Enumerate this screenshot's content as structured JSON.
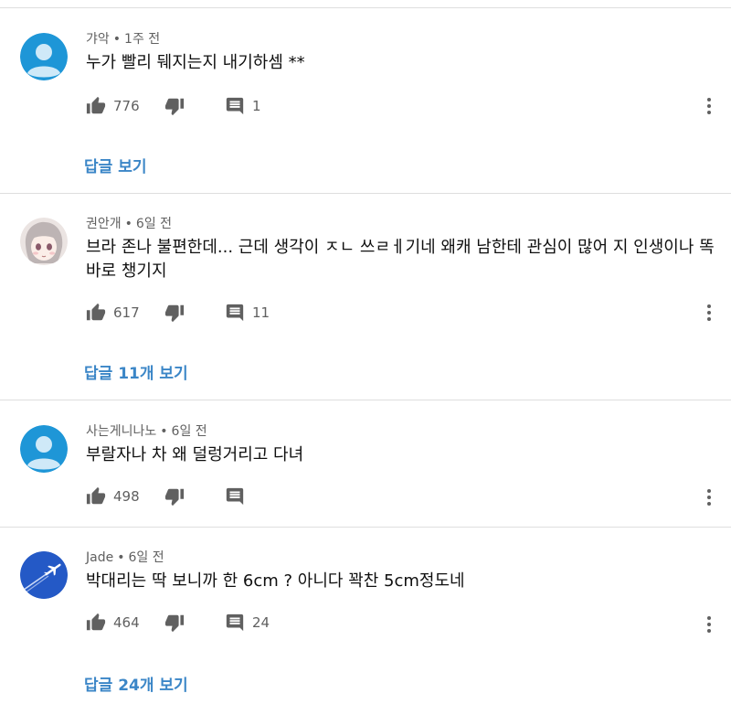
{
  "colors": {
    "accent": "#3b86c7",
    "meta_text": "#606060",
    "icon": "#606060",
    "divider": "#dedede"
  },
  "comments": [
    {
      "author": "갸악",
      "time": "1주 전",
      "text": "누가 빨리 뒈지는지 내기하셈 **",
      "likes": "776",
      "replies_count": "1",
      "reply_link": "답글 보기",
      "avatar": "default-person-avatar"
    },
    {
      "author": "권안개",
      "time": "6일 전",
      "text": "브라 존나 불편한데... 근데 생각이 ㅈㄴ 쓰ㄹㅔ기네 왜캐 남한테 관심이 많어 지 인생이나 똑바로 챙기지",
      "likes": "617",
      "replies_count": "11",
      "reply_link": "답글 11개 보기",
      "avatar": "anime-girl-avatar"
    },
    {
      "author": "사는게니나노",
      "time": "6일 전",
      "text": "부랄자나 차 왜 덜렁거리고 다녀",
      "likes": "498",
      "replies_count": "",
      "reply_link": "",
      "avatar": "default-person-avatar"
    },
    {
      "author": "Jade",
      "time": "6일 전",
      "text": "박대리는 딱 보니까 한 6cm ? 아니다 꽉찬 5cm정도네",
      "likes": "464",
      "replies_count": "24",
      "reply_link": "답글 24개 보기",
      "avatar": "airplane-avatar"
    }
  ],
  "icons": {
    "like": "thumbs-up-icon",
    "dislike": "thumbs-down-icon",
    "reply": "comment-icon",
    "more": "more-vert-icon"
  },
  "meta_separator": "•"
}
